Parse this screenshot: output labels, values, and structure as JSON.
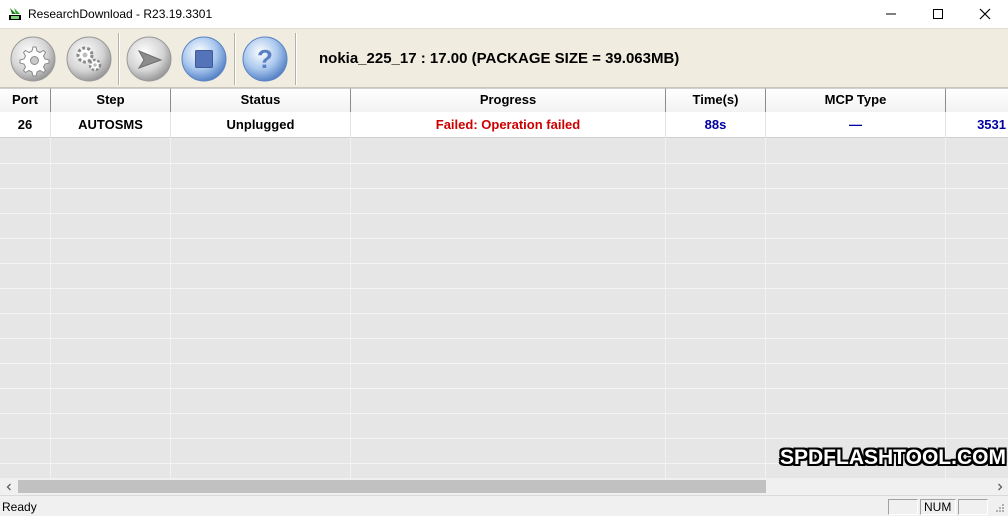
{
  "window": {
    "title": "ResearchDownload - R23.19.3301"
  },
  "toolbar": {
    "buttons": [
      {
        "name": "load-packet",
        "icon": "gear-icon"
      },
      {
        "name": "settings",
        "icon": "gears-icon"
      },
      {
        "name": "start-download",
        "icon": "play-icon"
      },
      {
        "name": "stop-download",
        "icon": "stop-icon"
      },
      {
        "name": "help",
        "icon": "question-icon"
      }
    ],
    "package_info": "nokia_225_17 : 17.00 (PACKAGE SIZE = 39.063MB)"
  },
  "grid": {
    "columns": [
      "Port",
      "Step",
      "Status",
      "Progress",
      "Time(s)",
      "MCP Type",
      ""
    ],
    "rows": [
      {
        "port": "26",
        "step": "AUTOSMS",
        "status": "Unplugged",
        "progress": "Failed: Operation failed",
        "time": "88s",
        "mcp_type": "—",
        "extra": "3531"
      }
    ]
  },
  "colors": {
    "failed_text": "#cc0000",
    "value_blue": "#0000a0",
    "toolbar_bg": "#f0ece0"
  },
  "statusbar": {
    "text": "Ready",
    "panes": [
      "",
      "NUM",
      ""
    ]
  },
  "watermark": "SPDFLASHTOOL.COM"
}
